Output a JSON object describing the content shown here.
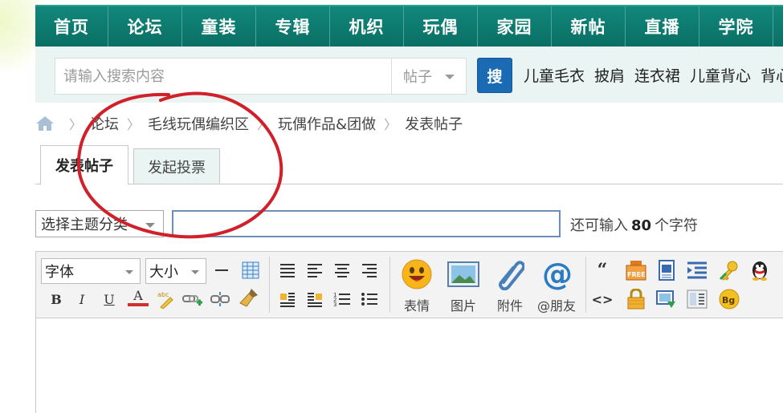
{
  "nav": {
    "items": [
      "首页",
      "论坛",
      "童装",
      "专辑",
      "机织",
      "玩偶",
      "家园",
      "新帖",
      "直播",
      "学院"
    ]
  },
  "search": {
    "placeholder": "请输入搜索内容",
    "scope": "帖子",
    "button_label": "搜",
    "hot_words": [
      "儿童毛衣",
      "披肩",
      "连衣裙",
      "儿童背心",
      "背心"
    ]
  },
  "breadcrumb": {
    "items": [
      "论坛",
      "毛线玩偶编织区",
      "玩偶作品&团做",
      "发表帖子"
    ]
  },
  "tabs": {
    "post": "发表帖子",
    "poll": "发起投票"
  },
  "subject": {
    "type_placeholder": "选择主题分类",
    "remain_prefix": "还可输入",
    "remain_count": "80",
    "remain_suffix": "个字符"
  },
  "editor": {
    "font_label": "字体",
    "size_label": "大小",
    "emoji_label": "表情",
    "image_label": "图片",
    "attach_label": "附件",
    "mention_label": "@朋友",
    "bold": "B",
    "italic": "I",
    "underline": "U",
    "font_color": "A",
    "quote": "“",
    "code": "<>",
    "bg_icon": "Bg",
    "free_icon": "FREE"
  },
  "colors": {
    "nav_bg": "#0a6f64",
    "search_bg": "#eaf4f2",
    "search_button": "#1a6bb3",
    "annotation": "#d0202a"
  }
}
